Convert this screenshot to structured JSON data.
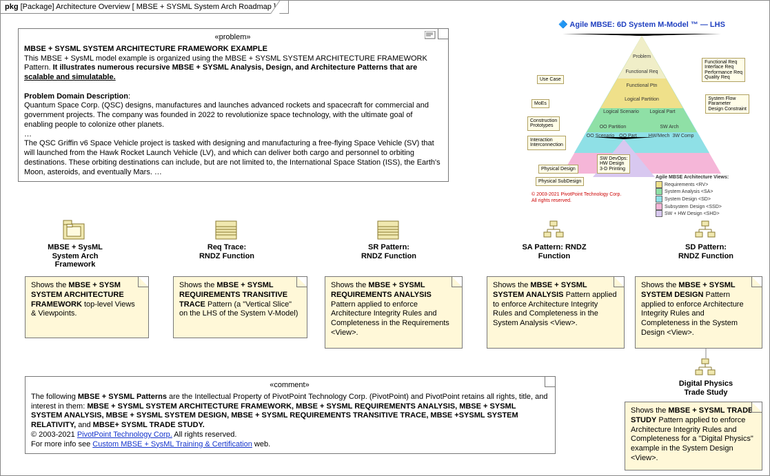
{
  "header": {
    "pkg_label": "pkg",
    "type_label": "[Package]",
    "title": "Architecture Overview",
    "subtitle": "[ MBSE + SYSML System Arch Roadmap ]"
  },
  "problem_note": {
    "stereotype": "«problem»",
    "heading": "MBSE + SYSML SYSTEM ARCHITECTURE FRAMEWORK EXAMPLE",
    "p1a": "This MBSE + SysML model example is organized using the MBSE + SYSML SYSTEM ARCHITECTURE FRAMEWORK Pattern. ",
    "p1b": "It illustrates numerous recursive MBSE + SYSML Analysis, Design, and Architecture Patterns that are ",
    "p1c_underlined": "scalable and simulatable.",
    "pd_head": "Problem Domain Description",
    "pd_body": "Quantum Space Corp. (QSC) designs, manufactures and launches advanced rockets and spacecraft for commercial and government projects. The company was founded in 2022 to revolutionize space technology, with the ultimate goal of enabling people to colonize other planets.",
    "ellipsis": "…",
    "p3": "The QSC Griffin v6 Space Vehicle project is tasked with designing and manufacturing a free-flying Space Vehicle (SV) that will launched from the Hawk Rocket Launch Vehicle (LV), and which can deliver both cargo and personnel to orbiting destinations. These orbiting destinations can include, but are not limited to, the International Space Station (ISS), the Earth's Moon, asteroids, and eventually Mars. …"
  },
  "triangle": {
    "title": "🔷 Agile MBSE: 6D System M-Model ™ — LHS",
    "callouts_right": [
      "Functional Req\nInterface Req\nPerformance Req\nQuality Req",
      "System Flow\nParameter\nDesign Constraint"
    ],
    "callouts_left": [
      "Use Case",
      "MoEs",
      "Construction\nPrototypes",
      "Interaction\nInterconnection",
      "Physical Design",
      "Physical SubDesign"
    ],
    "bands": [
      "Problem",
      "Functional Req",
      "Functional Ptn",
      "Logical Partition",
      "Logical Scenario",
      "Logical Part"
    ],
    "inner_left": [
      "OO Partition",
      "OO Scenario",
      "OO Part"
    ],
    "inner_right": [
      "SW Arch",
      "HW/Mech",
      "3W Comp"
    ],
    "under_left": [
      "SW DevOps:\nHW Design\n3-D Printing"
    ],
    "legend_title": "Agile MBSE Architecture Views:",
    "legend": [
      {
        "color": "#efe08a",
        "label": "Requirements <RV>"
      },
      {
        "color": "#8fe0a6",
        "label": "System Analysis <SA>"
      },
      {
        "color": "#8fe0e6",
        "label": "System Design <SD>"
      },
      {
        "color": "#f5b6d8",
        "label": "Subsystem Design <SSD>"
      },
      {
        "color": "#d8c8f0",
        "label": "SW + HW Design <SHD>"
      }
    ],
    "copyright": "© 2003-2021 PivotPoint Technology Corp.\nAll rights reserved."
  },
  "row1": [
    {
      "icon": "package",
      "label": "MBSE + SysML\nSystem Arch\nFramework",
      "note_pre": "Shows the ",
      "note_bold": "MBSE + SYSM SYSTEM ARCHITECTURE FRAMEWORK",
      "note_post": " top-level Views & Viewpoints."
    },
    {
      "icon": "class",
      "label": "Req Trace:\nRNDZ Function",
      "note_pre": "Shows the ",
      "note_bold": "MBSE + SYSML REQUIREMENTS TRANSITIVE TRACE",
      "note_post": " Pattern (a \"Vertical Slice\" on the LHS of the System V-Model)"
    },
    {
      "icon": "class",
      "label": "SR Pattern:\nRNDZ Function",
      "note_pre": "Shows the ",
      "note_bold": "MBSE + SYSML REQUIREMENTS ANALYSIS",
      "note_post": " Pattern applied to enforce Architecture Integrity Rules and Completeness in the Requirements <View>."
    },
    {
      "icon": "hier",
      "label": "SA Pattern: RNDZ\nFunction",
      "note_pre": "Shows the ",
      "note_bold": "MBSE + SYSML SYSTEM ANALYSIS",
      "note_post": " Pattern applied to enforce Architecture Integrity Rules and Completeness in the System Analysis <View>."
    },
    {
      "icon": "hier",
      "label": "SD Pattern:\nRNDZ Function",
      "note_pre": "Shows the ",
      "note_bold": "MBSE + SYSML SYSTEM DESIGN",
      "note_post": " Pattern applied to enforce Architecture Integrity Rules and Completeness in the System Design <View>."
    }
  ],
  "row2": {
    "icon": "hier",
    "label": "Digital Physics\nTrade Study",
    "note_pre": "Shows the ",
    "note_bold": "MBSE + SYSML TRADE STUDY",
    "note_post": " Pattern applied to enforce Architecture Integrity Rules and Completeness for a \"Digital Physics\" example in the System Design <View>."
  },
  "comment_note": {
    "stereotype": "«comment»",
    "p1a": "The following ",
    "p1b": "MBSE + SYSML Patterns",
    "p1c": " are the Intellectual Property of PivotPoint Technology Corp. (PivotPoint) and PivotPoint retains all rights, title, and interest in them: ",
    "p1d": "MBSE + SYSML SYSTEM ARCHITECTURE FRAMEWORK, MBSE + SYSML REQUIREMENTS ANALYSIS, MBSE + SYSML SYSTEM ANALYSIS, MBSE + SYSML SYSTEM DESIGN, MBSE + SYSML REQUIREMENTS TRANSITIVE TRACE, MBSE +SYSML SYSTEM RELATIVITY, ",
    "p1e": "and ",
    "p1f": "MBSE+ SYSML TRADE STUDY.",
    "p2a": "© 2003-2021 ",
    "p2_link": "PivotPoint Technology Corp.",
    "p2b": " All rights reserved.",
    "p3a": "For more info see ",
    "p3_link": "Custom MBSE + SysML Training & Certification",
    "p3b": " web."
  }
}
